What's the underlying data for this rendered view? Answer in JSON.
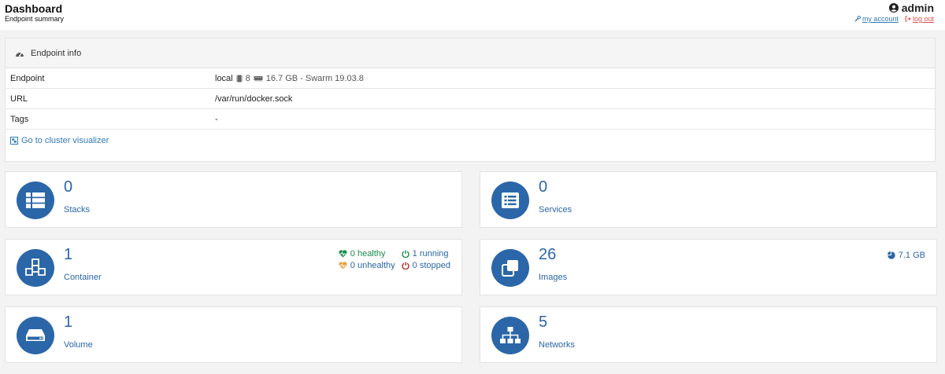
{
  "header": {
    "title": "Dashboard",
    "subtitle": "Endpoint summary",
    "user": "admin",
    "my_account": "my account",
    "log_out": "log out"
  },
  "endpoint_info": {
    "title": "Endpoint info",
    "rows": [
      {
        "key": "Endpoint",
        "value": "local",
        "cpu": "8",
        "memory": "16.7 GB - Swarm 19.03.8"
      },
      {
        "key": "URL",
        "value": "/var/run/docker.sock"
      },
      {
        "key": "Tags",
        "value": "-"
      }
    ],
    "visualizer_link": "Go to cluster visualizer"
  },
  "tiles": {
    "stacks": {
      "count": "0",
      "label": "Stacks"
    },
    "services": {
      "count": "0",
      "label": "Services"
    },
    "containers": {
      "count": "1",
      "label": "Container",
      "healthy": "0 healthy",
      "unhealthy": "0 unhealthy",
      "running": "1 running",
      "stopped": "0 stopped"
    },
    "images": {
      "count": "26",
      "label": "Images",
      "size": "7.1 GB"
    },
    "volumes": {
      "count": "1",
      "label": "Volume"
    },
    "networks": {
      "count": "5",
      "label": "Networks"
    }
  },
  "colors": {
    "accent": "#2b66a8",
    "healthy": "#1a8a4d",
    "unhealthy": "#e8a23b",
    "stopped": "#b32a2a",
    "logout": "#d9534f"
  }
}
